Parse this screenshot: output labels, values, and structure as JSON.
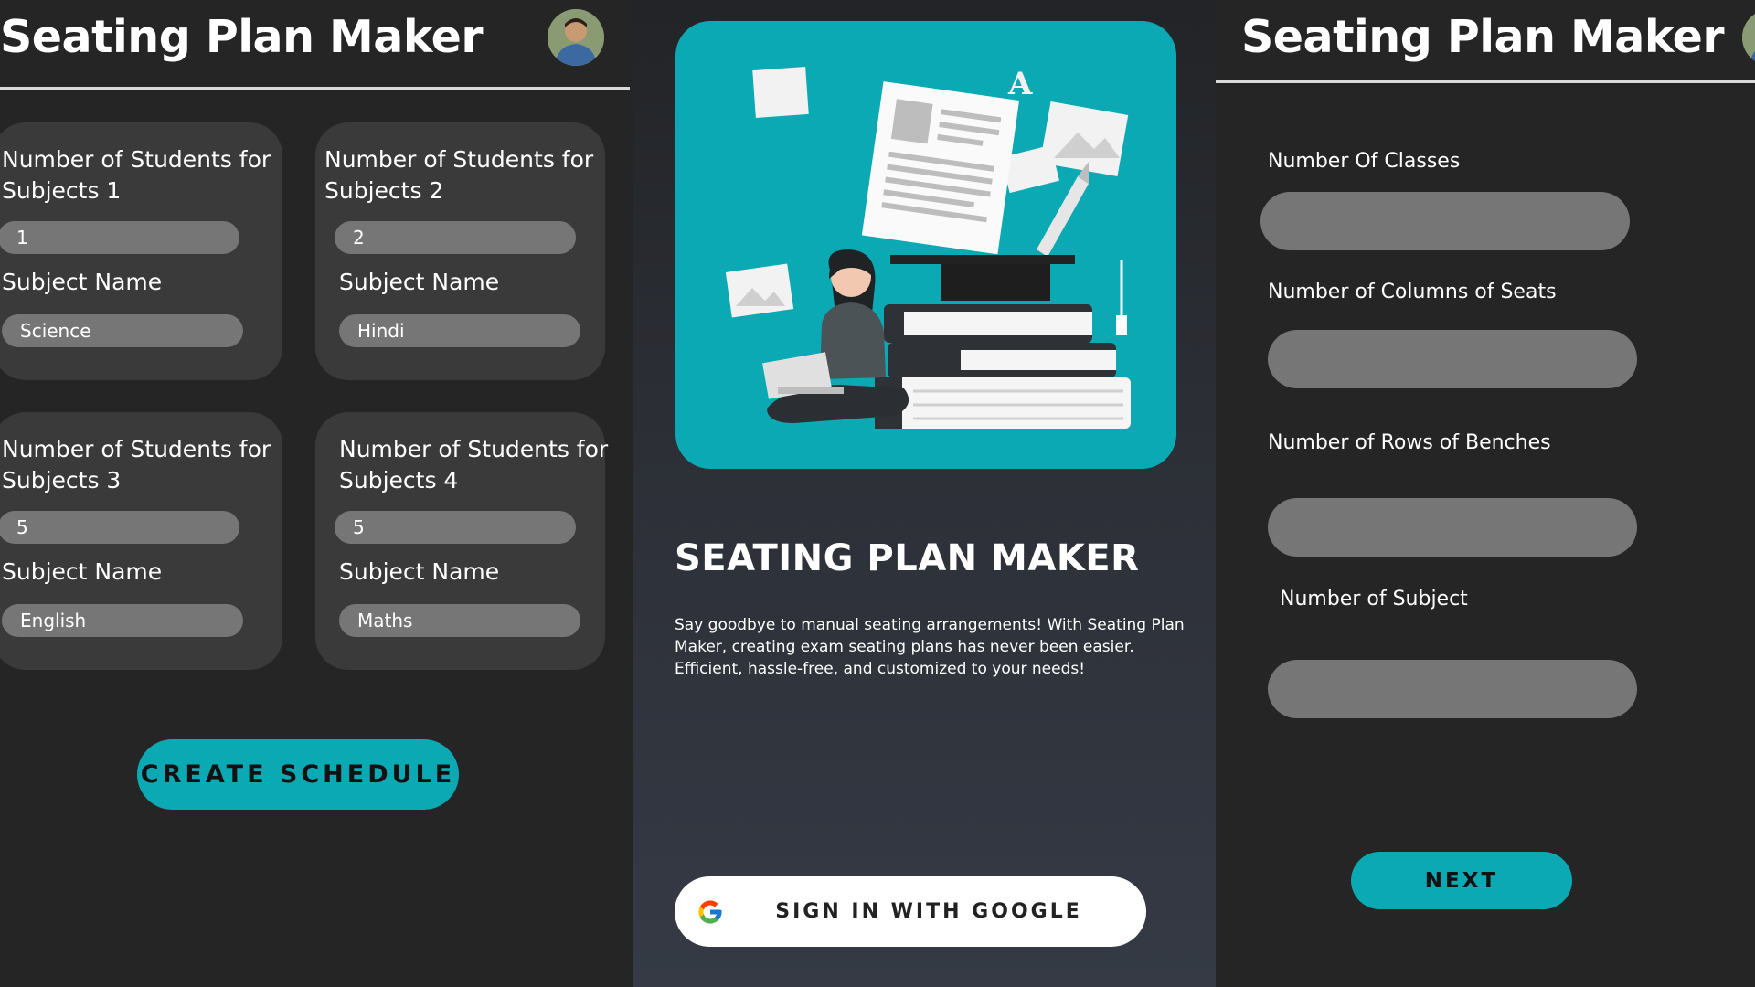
{
  "left_screen": {
    "title": "Seating Plan Maker",
    "cards": [
      {
        "heading": "Number of Students for Subjects 1",
        "count": "1",
        "subject_label": "Subject Name",
        "subject": "Science"
      },
      {
        "heading": "Number of Students for Subjects 2",
        "count": "2",
        "subject_label": "Subject Name",
        "subject": "Hindi"
      },
      {
        "heading": "Number of Students for Subjects 3",
        "count": "5",
        "subject_label": "Subject Name",
        "subject": "English"
      },
      {
        "heading": "Number of Students for Subjects 4",
        "count": "5",
        "subject_label": "Subject Name",
        "subject": "Maths"
      }
    ],
    "create_button": "CREATE SCHEDULE"
  },
  "middle_screen": {
    "hero_letter": "A",
    "title": "SEATING PLAN MAKER",
    "description": "Say goodbye to manual seating arrangements! With Seating Plan Maker, creating exam seating plans has never been easier. Efficient, hassle-free, and customized to your needs!",
    "google_button": "SIGN IN WITH GOOGLE",
    "google_icon": "google-g-icon"
  },
  "right_screen": {
    "title": "Seating Plan Maker",
    "fields": [
      {
        "label": "Number Of Classes",
        "value": ""
      },
      {
        "label": "Number of Columns of Seats",
        "value": ""
      },
      {
        "label": "Number of Rows of Benches",
        "value": ""
      },
      {
        "label": "Number of Subject",
        "value": ""
      }
    ],
    "next_button": "NEXT"
  },
  "colors": {
    "accent": "#0aa9b4",
    "background": "#252525",
    "card": "#3a3a3a",
    "input": "#767676"
  }
}
